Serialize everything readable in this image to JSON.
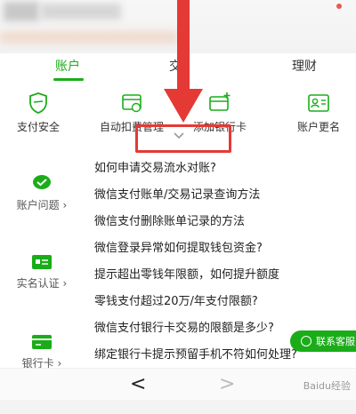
{
  "tabs": [
    {
      "label": "账户"
    },
    {
      "label": "交"
    },
    {
      "label": "理财"
    }
  ],
  "features": [
    {
      "label": "支付安全",
      "icon": "shield-icon"
    },
    {
      "label": "自动扣费管理",
      "icon": "auto-deduct-icon"
    },
    {
      "label": "添加银行卡",
      "icon": "add-card-icon"
    },
    {
      "label": "账户更名",
      "icon": "rename-account-icon"
    }
  ],
  "categories": [
    {
      "label": "账户问题",
      "icon": "account-check-icon"
    },
    {
      "label": "实名认证",
      "icon": "id-card-icon"
    },
    {
      "label": "银行卡",
      "icon": "bank-card-icon"
    }
  ],
  "questions": [
    "如何申请交易流水对账?",
    "微信支付账单/交易记录查询方法",
    "微信支付删除账单记录的方法",
    "微信登录异常如何提取钱包资金?",
    "提示超出零钱年限额，如何提升额度",
    "零钱支付超过20万/年支付限额?",
    "微信支付银行卡交易的限额是多少?",
    "绑定银行卡提示预留手机不符如何处理?"
  ],
  "contact_label": "联系客服",
  "nav": {
    "back": "<",
    "forward": ">"
  },
  "watermark": "Baidu经验",
  "colors": {
    "accent": "#1aad19",
    "annotation": "#e53935"
  }
}
